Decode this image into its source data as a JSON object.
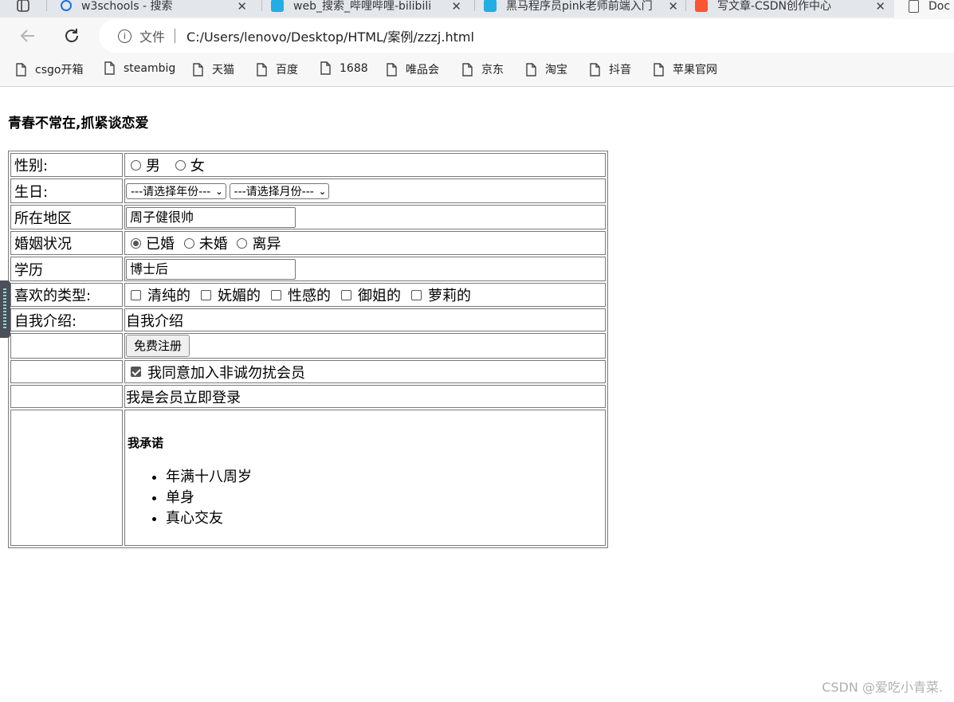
{
  "browser": {
    "tabs": [
      {
        "title": "w3schools - 搜索",
        "icon": "search-favicon",
        "color": "#1a73e8"
      },
      {
        "title": "web_搜索_哔哩哔哩-bilibili",
        "icon": "bilibili-favicon",
        "color": "#23ade5"
      },
      {
        "title": "黑马程序员pink老师前端入门",
        "icon": "bilibili-favicon",
        "color": "#23ade5"
      },
      {
        "title": "写文章-CSDN创作中心",
        "icon": "csdn-favicon",
        "color": "#fc5531"
      },
      {
        "title": "Doc",
        "icon": "page-favicon",
        "color": "#555555"
      }
    ],
    "address": {
      "protocol": "文件",
      "url": "C:/Users/lenovo/Desktop/HTML/案例/zzzj.html"
    },
    "bookmarks": [
      "csgo开箱",
      "steambig",
      "天猫",
      "百度",
      "1688",
      "唯品会",
      "京东",
      "淘宝",
      "抖音",
      "苹果官网"
    ]
  },
  "page": {
    "title": "青春不常在,抓紧谈恋爱",
    "rows": {
      "gender": {
        "label": "性别:",
        "options": [
          "男",
          "女"
        ]
      },
      "birthday": {
        "label": "生日:",
        "year_select": "---请选择年份---",
        "month_select": "---请选择月份---"
      },
      "region": {
        "label": "所在地区",
        "value": "周子健很帅"
      },
      "marital": {
        "label": "婚姻状况",
        "options": [
          "已婚",
          "未婚",
          "离异"
        ],
        "selected": "已婚"
      },
      "education": {
        "label": "学历",
        "value": "博士后"
      },
      "types": {
        "label": "喜欢的类型:",
        "options": [
          "清纯的",
          "妩媚的",
          "性感的",
          "御姐的",
          "萝莉的"
        ]
      },
      "intro": {
        "label": "自我介绍:",
        "value": "自我介绍"
      },
      "register": {
        "button": "免费注册"
      },
      "agree": {
        "text": "我同意加入非诚勿扰会员",
        "checked": true
      },
      "login": {
        "text": "我是会员立即登录"
      },
      "promise": {
        "heading": "我承诺",
        "items": [
          "年满十八周岁",
          "单身",
          "真心交友"
        ]
      }
    }
  },
  "watermark": "CSDN @爱吃小青菜."
}
